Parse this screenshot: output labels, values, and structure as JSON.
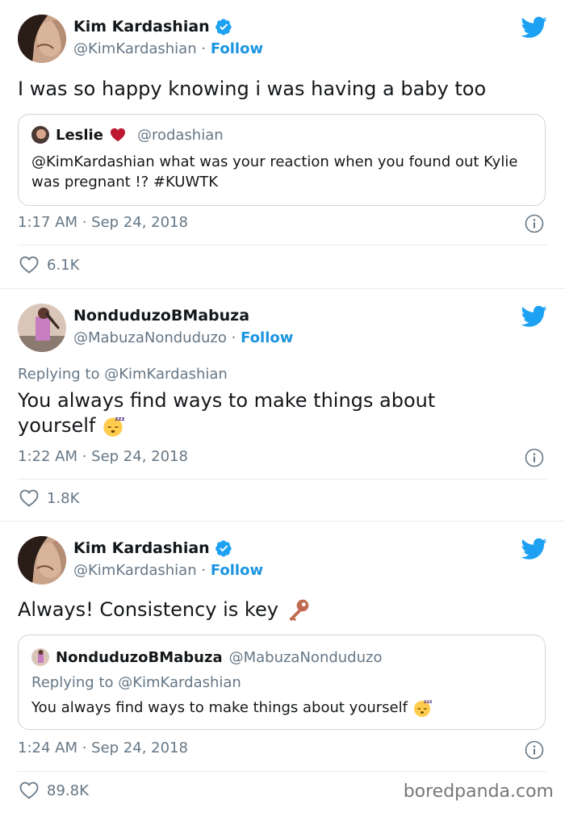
{
  "colors": {
    "twitter_blue": "#1da1f2",
    "follow": "#1b95e0",
    "muted": "#657786",
    "border": "#e6ecf0",
    "heart_red": "#e0245e"
  },
  "tweets": [
    {
      "name": "Kim Kardashian",
      "verified": true,
      "handle": "@KimKardashian",
      "separator": "·",
      "follow_label": "Follow",
      "text": "I was so happy knowing i was having a baby too",
      "quote": {
        "name": "Leslie",
        "name_emoji": "heart",
        "handle": "@rodashian",
        "text": "@KimKardashian  what was your reaction when you found out Kylie was pregnant !? #KUWTK"
      },
      "timestamp": "1:17 AM · Sep 24, 2018",
      "likes": "6.1K"
    },
    {
      "name": "NonduduzoBMabuza",
      "verified": false,
      "handle": "@MabuzaNonduduzo",
      "separator": "·",
      "follow_label": "Follow",
      "replying_to": "Replying to @KimKardashian",
      "text_line1": "You always find ways to make things about",
      "text_line2": "yourself",
      "text_emoji": "sleeping-face",
      "timestamp": "1:22 AM · Sep 24, 2018",
      "likes": "1.8K"
    },
    {
      "name": "Kim Kardashian",
      "verified": true,
      "handle": "@KimKardashian",
      "separator": "·",
      "follow_label": "Follow",
      "text": "Always! Consistency is key",
      "text_emoji": "key",
      "quote": {
        "name": "NonduduzoBMabuza",
        "handle": "@MabuzaNonduduzo",
        "replying_to": "Replying to @KimKardashian",
        "text": "You always find ways to make things about yourself",
        "text_emoji": "sleeping-face"
      },
      "timestamp": "1:24 AM · Sep 24, 2018",
      "likes": "89.8K"
    }
  ],
  "watermark": "boredpanda.com"
}
